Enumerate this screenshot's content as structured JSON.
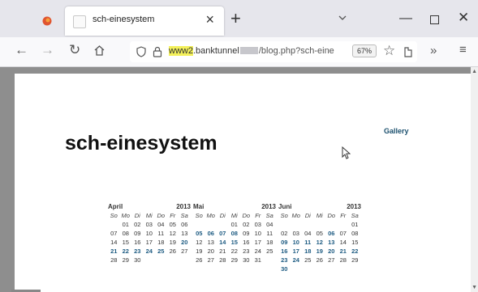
{
  "tab": {
    "title": "sch-einesystem"
  },
  "navbar": {
    "url_highlight": "www2",
    "url_domain": ".banktunnel",
    "url_path": "/blog.php?sch-eine",
    "zoom": "67%"
  },
  "page": {
    "title": "sch-einesystem",
    "gallery_link": "Gallery"
  },
  "calendars": [
    {
      "month": "April",
      "year": "2013",
      "weekdays": [
        "So",
        "Mo",
        "Di",
        "Mi",
        "Do",
        "Fr",
        "Sa"
      ],
      "weeks": [
        [
          "",
          "01",
          "02",
          "03",
          "04",
          "05",
          "06"
        ],
        [
          "07",
          "08",
          "09",
          "10",
          "11",
          "12",
          "13"
        ],
        [
          "14",
          "15",
          "16",
          "17",
          "18",
          "19",
          "20"
        ],
        [
          "21",
          "22",
          "23",
          "24",
          "25",
          "26",
          "27"
        ],
        [
          "28",
          "29",
          "30",
          "",
          "",
          "",
          ""
        ]
      ],
      "linked": [
        "20",
        "21",
        "22",
        "23",
        "24",
        "25"
      ]
    },
    {
      "month": "Mai",
      "year": "2013",
      "weekdays": [
        "So",
        "Mo",
        "Di",
        "Mi",
        "Do",
        "Fr",
        "Sa"
      ],
      "weeks": [
        [
          "",
          "",
          "",
          "01",
          "02",
          "03",
          "04"
        ],
        [
          "05",
          "06",
          "07",
          "08",
          "09",
          "10",
          "11"
        ],
        [
          "12",
          "13",
          "14",
          "15",
          "16",
          "17",
          "18"
        ],
        [
          "19",
          "20",
          "21",
          "22",
          "23",
          "24",
          "25"
        ],
        [
          "26",
          "27",
          "28",
          "29",
          "30",
          "31",
          ""
        ]
      ],
      "linked": [
        "05",
        "06",
        "07",
        "08",
        "14",
        "15"
      ]
    },
    {
      "month": "Juni",
      "year": "2013",
      "weekdays": [
        "So",
        "Mo",
        "Di",
        "Mi",
        "Do",
        "Fr",
        "Sa"
      ],
      "weeks": [
        [
          "",
          "",
          "",
          "",
          "",
          "",
          "01"
        ],
        [
          "02",
          "03",
          "04",
          "05",
          "06",
          "07",
          "08"
        ],
        [
          "09",
          "10",
          "11",
          "12",
          "13",
          "14",
          "15"
        ],
        [
          "16",
          "17",
          "18",
          "19",
          "20",
          "21",
          "22"
        ],
        [
          "23",
          "24",
          "25",
          "26",
          "27",
          "28",
          "29"
        ],
        [
          "30",
          "",
          "",
          "",
          "",
          "",
          ""
        ]
      ],
      "linked": [
        "06",
        "09",
        "10",
        "11",
        "12",
        "13",
        "16",
        "17",
        "18",
        "19",
        "20",
        "21",
        "22",
        "23",
        "24",
        "30"
      ]
    }
  ]
}
